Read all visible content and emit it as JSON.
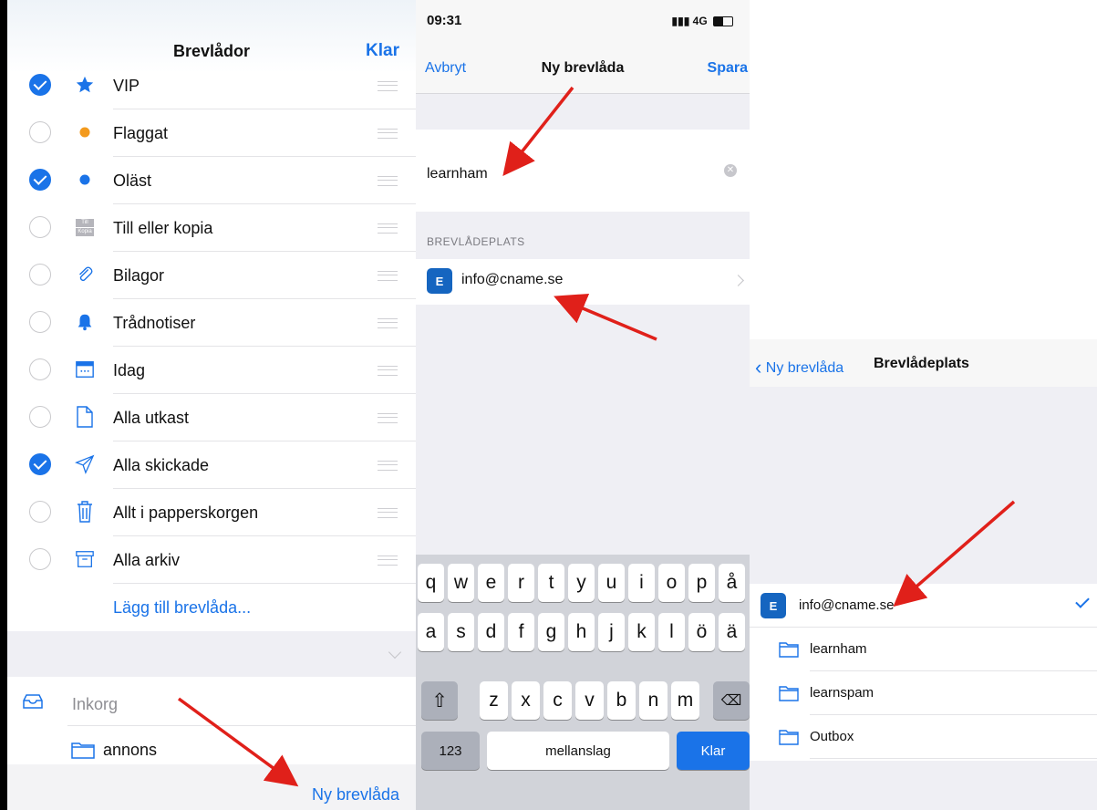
{
  "panel1": {
    "title": "Brevlådor",
    "done": "Klar",
    "items": [
      {
        "label": "VIP",
        "checked": true,
        "icon": "star-icon"
      },
      {
        "label": "Flaggat",
        "checked": false,
        "icon": "flag-dot-icon"
      },
      {
        "label": "Oläst",
        "checked": true,
        "icon": "unread-dot-icon"
      },
      {
        "label": "Till eller kopia",
        "checked": false,
        "icon": "to-cc-icon"
      },
      {
        "label": "Bilagor",
        "checked": false,
        "icon": "paperclip-icon"
      },
      {
        "label": "Trådnotiser",
        "checked": false,
        "icon": "bell-icon"
      },
      {
        "label": "Idag",
        "checked": false,
        "icon": "calendar-icon"
      },
      {
        "label": "Alla utkast",
        "checked": false,
        "icon": "document-icon"
      },
      {
        "label": "Alla skickade",
        "checked": true,
        "icon": "paper-plane-icon"
      },
      {
        "label": "Allt i papperskorgen",
        "checked": false,
        "icon": "trash-icon"
      },
      {
        "label": "Alla arkiv",
        "checked": false,
        "icon": "archive-icon"
      }
    ],
    "to_icon_top": "Till",
    "to_icon_bottom": "Kopia",
    "add_mailbox": "Lägg till brevlåda...",
    "inbox": "Inkorg",
    "folder": "annons",
    "new_mailbox": "Ny brevlåda"
  },
  "panel2": {
    "time": "09:31",
    "signal": "4G",
    "cancel": "Avbryt",
    "title": "Ny brevlåda",
    "save": "Spara",
    "name_value": "learnham",
    "section": "BREVLÅDEPLATS",
    "account": "info@cname.se",
    "keyboard": {
      "row1": [
        "q",
        "w",
        "e",
        "r",
        "t",
        "y",
        "u",
        "i",
        "o",
        "p",
        "å"
      ],
      "row2": [
        "a",
        "s",
        "d",
        "f",
        "g",
        "h",
        "j",
        "k",
        "l",
        "ö",
        "ä"
      ],
      "row3": [
        "z",
        "x",
        "c",
        "v",
        "b",
        "n",
        "m"
      ],
      "numbers": "123",
      "space": "mellanslag",
      "done": "Klar"
    }
  },
  "panel3": {
    "back": "Ny brevlåda",
    "title": "Brevlådeplats",
    "account": "info@cname.se",
    "folders": [
      "learnham",
      "learnspam",
      "Outbox"
    ]
  },
  "exchange_icon": "E",
  "colors": {
    "accent": "#1a73e8",
    "arrow": "#e0201a",
    "flag": "#f39a1d"
  }
}
